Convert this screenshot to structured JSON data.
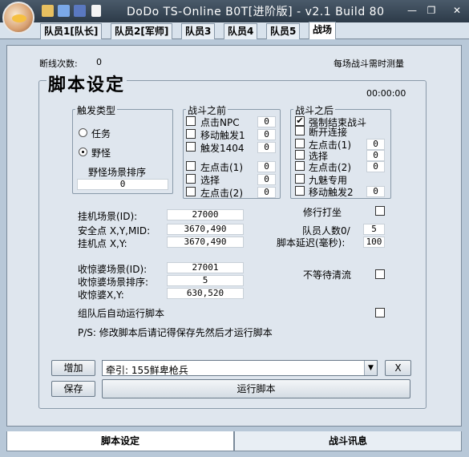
{
  "window": {
    "title": "DoDo TS-Online B0T[进阶版] - v2.1 Build 80"
  },
  "titlebar_icons": [
    "folder-icon",
    "save-icon",
    "disk-icon",
    "document-icon"
  ],
  "team_tabs": [
    "队员1[队长]",
    "队员2[军师]",
    "队员3",
    "队员4",
    "队员5",
    "战场"
  ],
  "status": {
    "disconnect_label": "断线次数:",
    "disconnect_count": "0",
    "timing_note": "每场战斗需时测量",
    "timer": "00:00:00"
  },
  "script_settings": {
    "title": "脚本设定"
  },
  "trigger_type": {
    "title": "触发类型",
    "options": [
      "任务",
      "野怪"
    ],
    "selected": "野怪",
    "sort_label": "野怪场景排序",
    "sort_value": "0"
  },
  "before_battle": {
    "title": "战斗之前",
    "items": [
      {
        "label": "点击NPC",
        "checked": false,
        "value": "0"
      },
      {
        "label": "移动触发1",
        "checked": false,
        "value": "0"
      },
      {
        "label": "触发1404",
        "checked": false,
        "value": "0"
      },
      {
        "label": "左点击(1)",
        "checked": false,
        "value": "0"
      },
      {
        "label": "选择",
        "checked": false,
        "value": "0"
      },
      {
        "label": "左点击(2)",
        "checked": false,
        "value": "0"
      }
    ]
  },
  "after_battle": {
    "title": "战斗之后",
    "items": [
      {
        "label": "强制结束战斗",
        "checked": true,
        "value": null
      },
      {
        "label": "断开连接",
        "checked": false,
        "value": null
      },
      {
        "label": "左点击(1)",
        "checked": false,
        "value": "0"
      },
      {
        "label": "选择",
        "checked": false,
        "value": "0"
      },
      {
        "label": "左点击(2)",
        "checked": false,
        "value": "0"
      },
      {
        "label": "九魅专用",
        "checked": false,
        "value": null
      },
      {
        "label": "移动触发2",
        "checked": false,
        "value": "0"
      }
    ]
  },
  "location": {
    "hang_scene_label": "挂机场景(ID):",
    "hang_scene_value": "27000",
    "safe_point_label": "安全点 X,Y,MID:",
    "safe_point_value": "3670,490",
    "hang_point_label": "挂机点 X,Y:",
    "hang_point_value": "3670,490",
    "collector_scene_label": "收惊婆场景(ID):",
    "collector_scene_value": "27001",
    "collector_sort_label": "收惊婆场景排序:",
    "collector_sort_value": "5",
    "collector_xy_label": "收惊婆X,Y:",
    "collector_xy_value": "630,520"
  },
  "right_options": {
    "cultivate_label": "修行打坐",
    "cultivate_checked": false,
    "team_count_label": "队员人数0/",
    "team_count_value": "5",
    "delay_label": "脚本延迟(毫秒):",
    "delay_value": "100",
    "no_wait_label": "不等待清流",
    "no_wait_checked": false
  },
  "auto_run": {
    "label": "组队后自动运行脚本",
    "checked": false
  },
  "note": "P/S: 修改脚本后请记得保存先然后才运行脚本",
  "actions": {
    "add_label": "增加",
    "save_label": "保存",
    "run_label": "运行脚本",
    "close_label": "X",
    "combo_value": "牵引: 155鲜卑枪兵"
  },
  "bottom_tabs": [
    "脚本设定",
    "战斗讯息"
  ]
}
